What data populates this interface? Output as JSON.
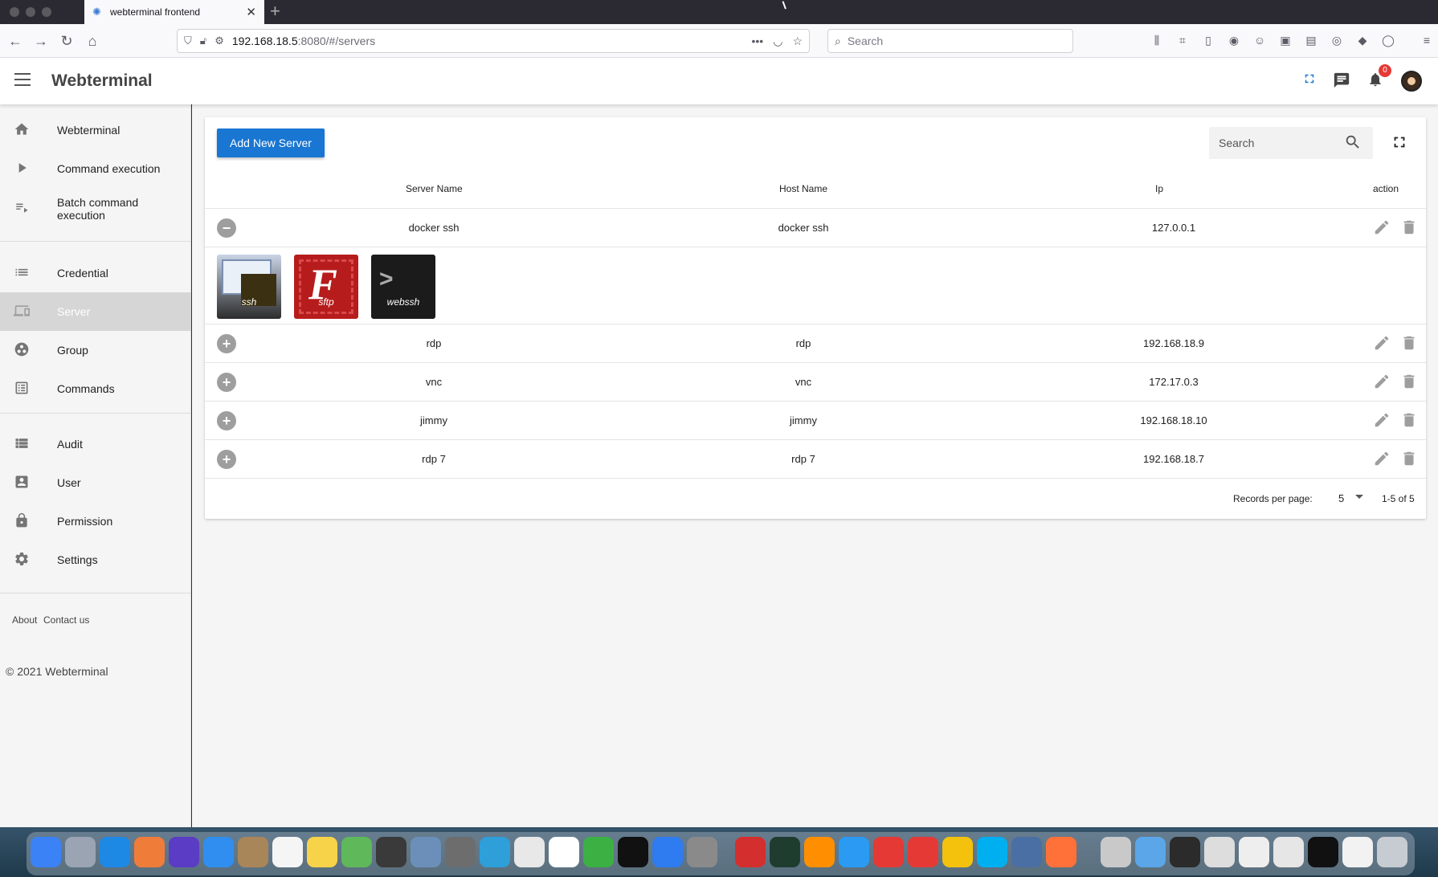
{
  "browser": {
    "tab_title": "webterminal frontend",
    "url_host": "192.168.18.5",
    "url_rest": ":8080/#/servers",
    "search_placeholder": "Search"
  },
  "header": {
    "title": "Webterminal",
    "notification_count": "0"
  },
  "sidebar": {
    "items": [
      {
        "label": "Webterminal",
        "icon": "home-icon"
      },
      {
        "label": "Command execution",
        "icon": "play-icon"
      },
      {
        "label": "Batch command execution",
        "icon": "playlist-icon"
      },
      {
        "label": "Credential",
        "icon": "list-icon"
      },
      {
        "label": "Server",
        "icon": "devices-icon",
        "active": true
      },
      {
        "label": "Group",
        "icon": "group-icon"
      },
      {
        "label": "Commands",
        "icon": "commands-icon"
      },
      {
        "label": "Audit",
        "icon": "audit-icon"
      },
      {
        "label": "User",
        "icon": "user-icon"
      },
      {
        "label": "Permission",
        "icon": "lock-icon"
      },
      {
        "label": "Settings",
        "icon": "gear-icon"
      }
    ],
    "about": "About",
    "contact": "Contact us",
    "copyright": "© 2021 Webterminal"
  },
  "main": {
    "add_button": "Add New Server",
    "search_placeholder": "Search",
    "columns": [
      "Server Name",
      "Host Name",
      "Ip",
      "action"
    ],
    "rows": [
      {
        "server_name": "docker ssh",
        "host_name": "docker ssh",
        "ip": "127.0.0.1",
        "expanded": true
      },
      {
        "server_name": "rdp",
        "host_name": "rdp",
        "ip": "192.168.18.9",
        "expanded": false
      },
      {
        "server_name": "vnc",
        "host_name": "vnc",
        "ip": "172.17.0.3",
        "expanded": false
      },
      {
        "server_name": "jimmy",
        "host_name": "jimmy",
        "ip": "192.168.18.10",
        "expanded": false
      },
      {
        "server_name": "rdp 7",
        "host_name": "rdp 7",
        "ip": "192.168.18.7",
        "expanded": false
      }
    ],
    "connect_tiles": [
      "ssh",
      "sftp",
      "webssh"
    ],
    "records_per_page_label": "Records per page:",
    "records_per_page_value": "5",
    "page_range": "1-5 of 5"
  },
  "colors": {
    "primary": "#1976d2",
    "badge": "#e53935",
    "active_nav": "#d6d6d6"
  }
}
